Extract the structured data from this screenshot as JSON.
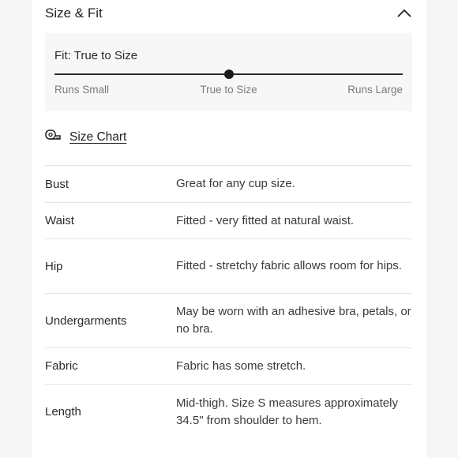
{
  "section": {
    "title": "Size & Fit"
  },
  "fit": {
    "title": "Fit: True to Size",
    "scale_left": "Runs Small",
    "scale_mid": "True to Size",
    "scale_right": "Runs Large",
    "position": 0.5
  },
  "size_chart": {
    "label": "Size Chart"
  },
  "details": [
    {
      "label": "Bust",
      "value": "Great for any cup size."
    },
    {
      "label": "Waist",
      "value": "Fitted - very fitted at natural waist."
    },
    {
      "label": "Hip",
      "value": "Fitted - stretchy fabric allows room for hips."
    },
    {
      "label": "Undergarments",
      "value": "May be worn with an adhesive bra, petals, or no bra."
    },
    {
      "label": "Fabric",
      "value": "Fabric has some stretch."
    },
    {
      "label": "Length",
      "value": "Mid-thigh. Size S measures approximately 34.5\" from shoulder to hem."
    }
  ]
}
